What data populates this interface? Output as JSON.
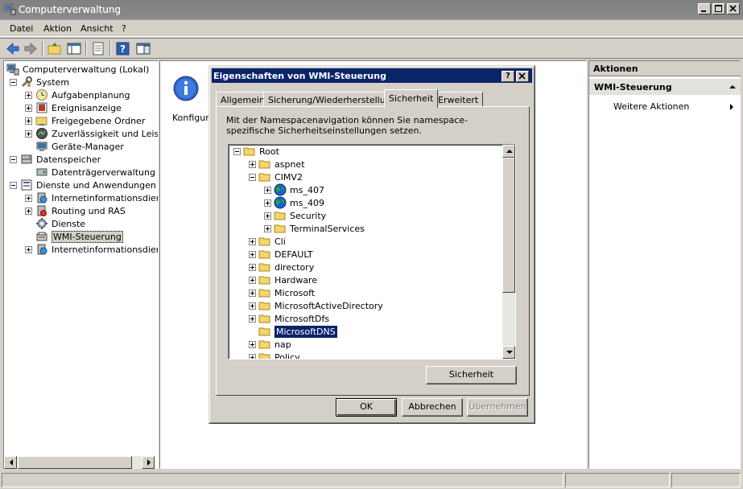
{
  "window": {
    "title": "Computerverwaltung"
  },
  "menu": {
    "items": [
      "Datei",
      "Aktion",
      "Ansicht",
      "?"
    ]
  },
  "tree": {
    "items": [
      {
        "label": "Computerverwaltung (Lokal)",
        "icon": "computer-icon"
      },
      {
        "label": "System",
        "icon": "tools-icon"
      },
      {
        "label": "Aufgabenplanung",
        "icon": "clock-icon"
      },
      {
        "label": "Ereignisanzeige",
        "icon": "event-viewer-icon"
      },
      {
        "label": "Freigegebene Ordner",
        "icon": "shared-folder-icon"
      },
      {
        "label": "Zuverlässigkeit und Leistung",
        "icon": "performance-icon"
      },
      {
        "label": "Geräte-Manager",
        "icon": "device-manager-icon"
      },
      {
        "label": "Datenspeicher",
        "icon": "storage-icon"
      },
      {
        "label": "Datenträgerverwaltung",
        "icon": "disk-icon"
      },
      {
        "label": "Dienste und Anwendungen",
        "icon": "services-apps-icon"
      },
      {
        "label": "Internetinformationsdienste",
        "icon": "iis-icon"
      },
      {
        "label": "Routing und RAS",
        "icon": "routing-icon"
      },
      {
        "label": "Dienste",
        "icon": "gear-icon"
      },
      {
        "label": "WMI-Steuerung",
        "icon": "wmi-icon"
      },
      {
        "label": "Internetinformationsdienste",
        "icon": "iis-icon"
      }
    ]
  },
  "center": {
    "info_text": "Konfigurie"
  },
  "actions": {
    "header": "Aktionen",
    "section": "WMI-Steuerung",
    "item": "Weitere Aktionen"
  },
  "dialog": {
    "title": "Eigenschaften von WMI-Steuerung",
    "help_btn": "?",
    "tabs": [
      "Allgemein",
      "Sicherung/Wiederherstellung",
      "Sicherheit",
      "Erweitert"
    ],
    "active_tab": "Sicherheit",
    "description": "Mit der Namespacenavigation können Sie namespace-spezifische Sicherheitseinstellungen setzen.",
    "namespaces": [
      {
        "label": "Root"
      },
      {
        "label": "aspnet"
      },
      {
        "label": "CIMV2"
      },
      {
        "label": "ms_407"
      },
      {
        "label": "ms_409"
      },
      {
        "label": "Security"
      },
      {
        "label": "TerminalServices"
      },
      {
        "label": "Cli"
      },
      {
        "label": "DEFAULT"
      },
      {
        "label": "directory"
      },
      {
        "label": "Hardware"
      },
      {
        "label": "Microsoft"
      },
      {
        "label": "MicrosoftActiveDirectory"
      },
      {
        "label": "MicrosoftDfs"
      },
      {
        "label": "MicrosoftDNS",
        "selected": true
      },
      {
        "label": "nap"
      },
      {
        "label": "Policy"
      }
    ],
    "security_btn": "Sicherheit",
    "ok_btn": "OK",
    "cancel_btn": "Abbrechen",
    "apply_btn": "Übernehmen"
  },
  "colors": {
    "selection": "#0a246a",
    "face": "#d4d0c8"
  }
}
